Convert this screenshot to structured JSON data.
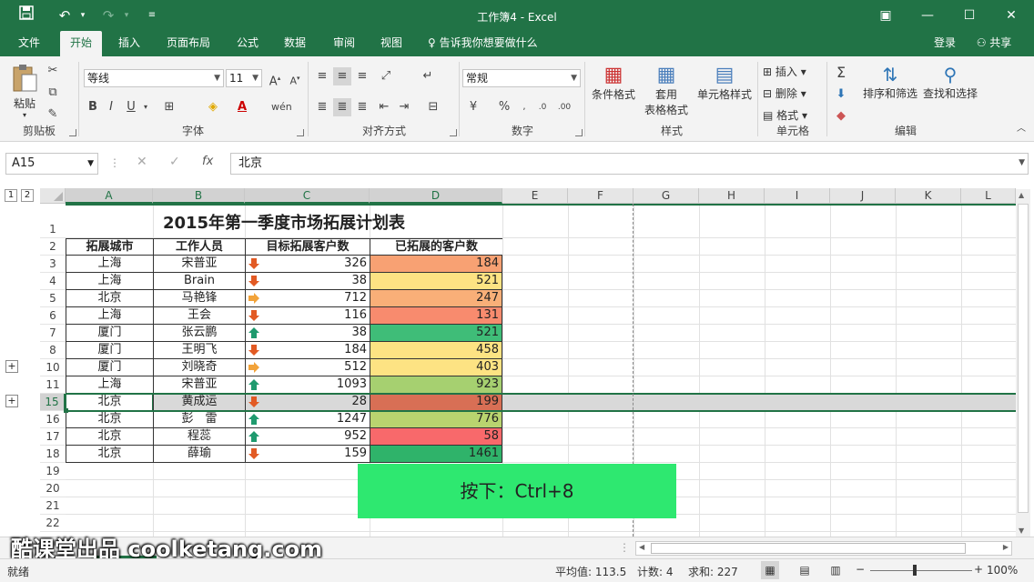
{
  "titlebar": {
    "title": "工作簿4 - Excel",
    "save_icon": "save-icon",
    "undo_icon": "undo-icon",
    "redo_icon": "redo-icon"
  },
  "tabs": [
    "文件",
    "开始",
    "插入",
    "页面布局",
    "公式",
    "数据",
    "审阅",
    "视图"
  ],
  "tellme": "告诉我你想要做什么",
  "login": "登录",
  "share": "共享",
  "ribbon": {
    "clipboard": {
      "paste": "粘贴",
      "label": "剪贴板"
    },
    "font": {
      "name": "等线",
      "size": "11",
      "label": "字体"
    },
    "align": {
      "label": "对齐方式"
    },
    "number": {
      "format": "常规",
      "label": "数字"
    },
    "styles": {
      "cond": "条件格式",
      "table1": "套用",
      "table2": "表格格式",
      "cell": "单元格样式",
      "label": "样式"
    },
    "cells": {
      "insert": "插入",
      "delete": "删除",
      "format": "格式",
      "label": "单元格"
    },
    "editing": {
      "sort": "排序和筛选",
      "find": "查找和选择",
      "label": "编辑"
    }
  },
  "formula": {
    "namebox": "A15",
    "value": "北京"
  },
  "outline": {
    "level1": "1",
    "level2": "2",
    "expand": "+"
  },
  "columns": [
    "A",
    "B",
    "C",
    "D",
    "E",
    "F",
    "G",
    "H",
    "I",
    "J",
    "K",
    "L"
  ],
  "title": "2015年第一季度市场拓展计划表",
  "headers": [
    "拓展城市",
    "工作人员",
    "目标拓展客户数",
    "已拓展的客户数"
  ],
  "rows": [
    {
      "row": "3",
      "city": "上海",
      "staff": "宋普亚",
      "target": "326",
      "done": "184",
      "arrow": "down",
      "fill": "#f8a173"
    },
    {
      "row": "4",
      "city": "上海",
      "staff": "Brain",
      "target": "38",
      "done": "521",
      "arrow": "down",
      "fill": "#fde383"
    },
    {
      "row": "5",
      "city": "北京",
      "staff": "马艳锋",
      "target": "712",
      "done": "247",
      "arrow": "right",
      "fill": "#f9af78"
    },
    {
      "row": "6",
      "city": "上海",
      "staff": "王会",
      "target": "116",
      "done": "131",
      "arrow": "down",
      "fill": "#f88b6e"
    },
    {
      "row": "7",
      "city": "厦门",
      "staff": "张云鹏",
      "target": "38",
      "done": "521",
      "arrow": "up",
      "fill": "#3fbd78"
    },
    {
      "row": "8",
      "city": "厦门",
      "staff": "王明飞",
      "target": "184",
      "done": "458",
      "arrow": "down",
      "fill": "#fde383"
    },
    {
      "row": "10",
      "city": "厦门",
      "staff": "刘晓奇",
      "target": "512",
      "done": "403",
      "arrow": "right",
      "fill": "#fde383"
    },
    {
      "row": "11",
      "city": "上海",
      "staff": "宋普亚",
      "target": "1093",
      "done": "923",
      "arrow": "up",
      "fill": "#a6d070"
    },
    {
      "row": "15",
      "city": "北京",
      "staff": "黄成运",
      "target": "28",
      "done": "199",
      "arrow": "down",
      "fill": "#d86f55"
    },
    {
      "row": "16",
      "city": "北京",
      "staff": "彭　雷",
      "target": "1247",
      "done": "776",
      "arrow": "up",
      "fill": "#b9d46f"
    },
    {
      "row": "17",
      "city": "北京",
      "staff": "程蕊",
      "target": "952",
      "done": "58",
      "arrow": "up",
      "fill": "#f8696b"
    },
    {
      "row": "18",
      "city": "北京",
      "staff": "薛瑜",
      "target": "159",
      "done": "1461",
      "arrow": "down",
      "fill": "#2fb36a"
    }
  ],
  "empty_rows": [
    "19",
    "20",
    "21",
    "22"
  ],
  "tip": "按下：Ctrl+8",
  "watermark": "酷课堂出品 coolketang.com",
  "status": {
    "ready": "就绪",
    "avg": "平均值: 113.5",
    "count": "计数: 4",
    "sum": "求和: 227",
    "zoom": "100%"
  }
}
